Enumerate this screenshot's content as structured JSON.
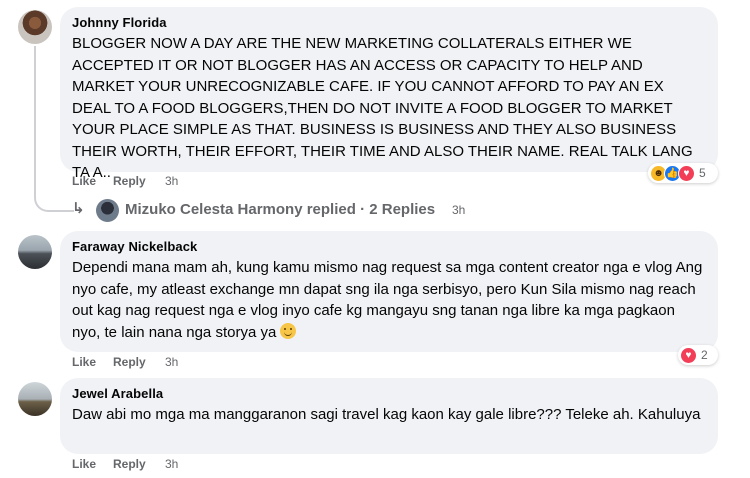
{
  "comments": [
    {
      "author": "Johnny Florida",
      "text": "BLOGGER NOW A DAY ARE THE NEW MARKETING COLLATERALS EITHER WE ACCEPTED IT OR NOT BLOGGER HAS AN ACCESS OR CAPACITY TO HELP AND MARKET YOUR UNRECOGNIZABLE CAFE. IF YOU CANNOT AFFORD TO PAY AN EX DEAL TO A FOOD BLOGGERS,THEN DO NOT INVITE A FOOD BLOGGER TO MARKET YOUR PLACE SIMPLE AS THAT. BUSINESS IS BUSINESS AND THEY ALSO BUSINESS THEIR WORTH, THEIR EFFORT, THEIR TIME AND ALSO THEIR NAME. REAL TALK LANG TA A..",
      "like_label": "Like",
      "reply_label": "Reply",
      "time": "3h",
      "reactions": [
        "haha-icon",
        "like-icon",
        "love-icon"
      ],
      "reaction_count": "5"
    },
    {
      "author": "Faraway Nickelback",
      "text": "Dependi mana mam ah, kung kamu mismo nag request sa mga content creator nga e vlog Ang nyo cafe, my atleast exchange mn dapat sng ila nga serbisyo, pero Kun Sila mismo nag reach out kag nag request nga e vlog inyo cafe kg mangayu sng tanan nga libre ka mga pagkaon nyo, te lain nana nga storya ya",
      "like_label": "Like",
      "reply_label": "Reply",
      "time": "3h",
      "reactions": [
        "love-icon"
      ],
      "reaction_count": "2"
    },
    {
      "author": "Jewel Arabella",
      "text": "Daw abi mo mga ma manggaranon sagi travel kag kaon kay gale libre??? Teleke ah. Kahuluya",
      "like_label": "Like",
      "reply_label": "Reply",
      "time": "3h"
    }
  ],
  "reply_thread": {
    "label": "Mizuko Celesta Harmony replied · 2 Replies",
    "time": "3h"
  },
  "colors": {
    "bubble": "#f0f2f5",
    "meta_text": "#65676b",
    "like_blue": "#1877f2",
    "love_red": "#f33e58",
    "haha_yellow": "#f7b928"
  }
}
